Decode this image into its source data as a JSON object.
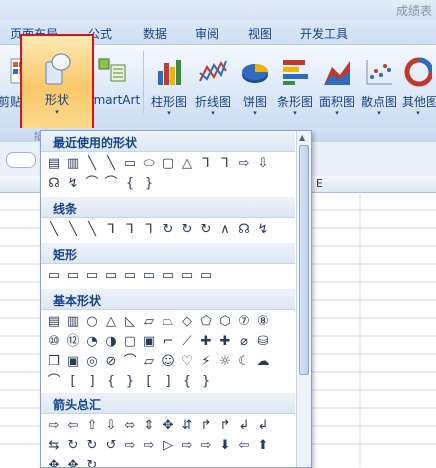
{
  "window": {
    "title_partial": "成绩表"
  },
  "tabs": [
    "页面布局",
    "公式",
    "数据",
    "审阅",
    "视图",
    "开发工具"
  ],
  "ribbon": {
    "left_partial_label": "剪贴画",
    "shape_label": "形状",
    "smartart_label": "SmartArt",
    "charts": [
      "柱形图",
      "折线图",
      "饼图",
      "条形图",
      "面积图",
      "散点图",
      "其他图"
    ]
  },
  "groupbar": {
    "left": "插"
  },
  "sheet": {
    "column_letter": "E"
  },
  "dropdown": {
    "sections": [
      {
        "title": "最近使用的形状",
        "rows": [
          [
            "▤",
            "▥",
            "╲",
            "╲",
            "▭",
            "⬭",
            "▢",
            "△",
            "⅂",
            "⅂",
            "⇨",
            "⇩"
          ],
          [
            "☊",
            "↯",
            "⌒",
            "⌒",
            "{",
            "}"
          ]
        ]
      },
      {
        "title": "线条",
        "rows": [
          [
            "╲",
            "╲",
            "╲",
            "⅂",
            "⅂",
            "⅂",
            "↻",
            "↻",
            "↻",
            "∧",
            "☊",
            "↯"
          ]
        ]
      },
      {
        "title": "矩形",
        "rows": [
          [
            "▭",
            "▭",
            "▭",
            "▭",
            "▭",
            "▭",
            "▭",
            "▭",
            "▭"
          ]
        ]
      },
      {
        "title": "基本形状",
        "rows": [
          [
            "▤",
            "▥",
            "○",
            "△",
            "◺",
            "▱",
            "⏢",
            "◇",
            "⬠",
            "⬡",
            "⑦",
            "⑧"
          ],
          [
            "⑩",
            "⑫",
            "◔",
            "◑",
            "▢",
            "▣",
            "⌐",
            "⟋",
            "✚",
            "✚",
            "⌀",
            "⛁"
          ],
          [
            "❒",
            "▣",
            "◎",
            "⊘",
            "⌒",
            "▱",
            "☺",
            "♡",
            "⚡",
            "☼",
            "☾",
            "☁"
          ],
          [
            "⌒",
            "[",
            "]",
            "{",
            "}",
            "[",
            "]",
            "{",
            "}"
          ]
        ]
      },
      {
        "title": "箭头总汇",
        "rows": [
          [
            "⇨",
            "⇦",
            "⇧",
            "⇩",
            "⬄",
            "⇕",
            "✥",
            "⇵",
            "↱",
            "↱",
            "↲",
            "↲"
          ],
          [
            "⇆",
            "↻",
            "↻",
            "↺",
            "⇨",
            "⇨",
            "▷",
            "⇨",
            "⇨",
            "⬇",
            "⇦",
            "⬆"
          ],
          [
            "✥",
            "✥",
            "↻"
          ]
        ]
      }
    ]
  }
}
